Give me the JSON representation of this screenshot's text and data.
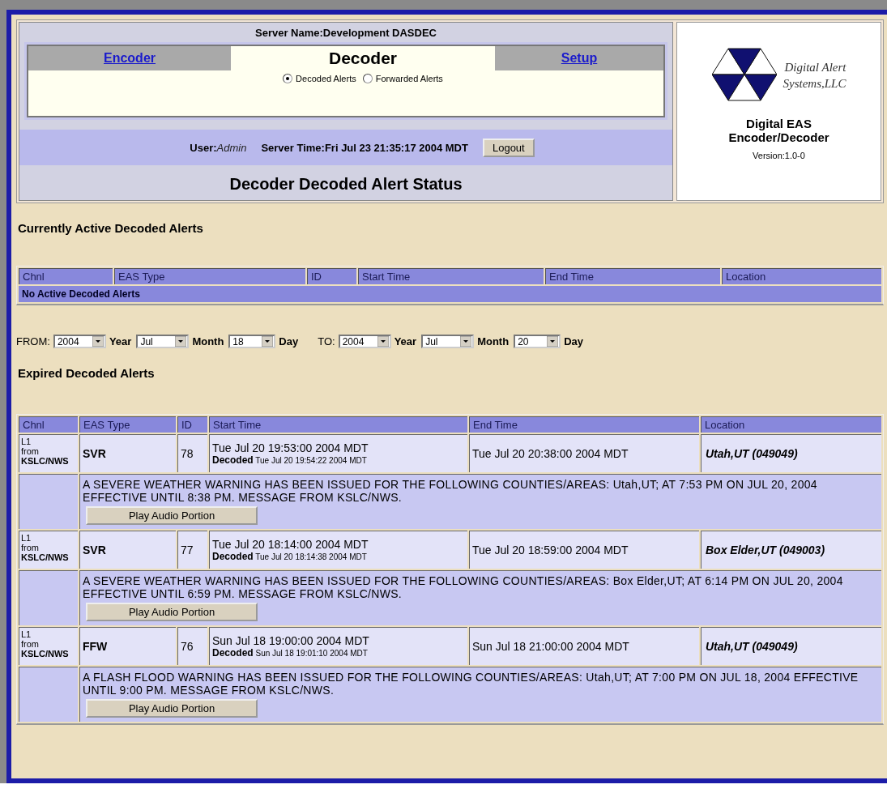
{
  "header": {
    "server_name": "Server Name:Development DASDEC",
    "tabs": [
      {
        "label": "Encoder",
        "selected": false
      },
      {
        "label": "Decoder",
        "selected": true
      },
      {
        "label": "Setup",
        "selected": false
      }
    ],
    "radios": [
      {
        "label": "Decoded Alerts",
        "selected": true
      },
      {
        "label": "Forwarded Alerts",
        "selected": false
      }
    ],
    "user_label": "User:",
    "user": "Admin",
    "server_time": "Server Time:Fri Jul 23 21:35:17 2004 MDT",
    "logout": "Logout",
    "page_title": "Decoder Decoded Alert Status"
  },
  "logo": {
    "company_lines": [
      "Digital Alert",
      "Systems,LLC"
    ],
    "product": "Digital EAS Encoder/Decoder",
    "version": "Version:1.0-0"
  },
  "active": {
    "title": "Currently Active Decoded Alerts",
    "columns": [
      "Chnl",
      "EAS Type",
      "ID",
      "Start Time",
      "End Time",
      "Location"
    ],
    "empty_message": "No Active Decoded Alerts"
  },
  "date_filter": {
    "from_label": "FROM:",
    "to_label": "TO:",
    "from": [
      {
        "value": "2004",
        "unit": "Year"
      },
      {
        "value": "Jul",
        "unit": "Month"
      },
      {
        "value": "18",
        "unit": "Day"
      }
    ],
    "to": [
      {
        "value": "2004",
        "unit": "Year"
      },
      {
        "value": "Jul",
        "unit": "Month"
      },
      {
        "value": "20",
        "unit": "Day"
      }
    ]
  },
  "expired": {
    "title": "Expired Decoded Alerts",
    "columns": [
      "Chnl",
      "EAS Type",
      "ID",
      "Start Time",
      "End Time",
      "Location"
    ],
    "rows": [
      {
        "channel": "L1",
        "channel_from": "from",
        "channel_source": "KSLC/NWS",
        "eas_type": "SVR",
        "id": "78",
        "start_time": "Tue Jul 20 19:53:00 2004 MDT",
        "decoded_label": "Decoded",
        "decoded_time": "Tue Jul 20 19:54:22 2004 MDT",
        "end_time": "Tue Jul 20 20:38:00 2004 MDT",
        "location": "Utah,UT (049049)",
        "message": "A SEVERE WEATHER WARNING HAS BEEN ISSUED FOR THE FOLLOWING COUNTIES/AREAS: Utah,UT; AT 7:53 PM ON JUL 20, 2004 EFFECTIVE UNTIL 8:38 PM. MESSAGE FROM KSLC/NWS.",
        "play_button": "Play Audio Portion"
      },
      {
        "channel": "L1",
        "channel_from": "from",
        "channel_source": "KSLC/NWS",
        "eas_type": "SVR",
        "id": "77",
        "start_time": "Tue Jul 20 18:14:00 2004 MDT",
        "decoded_label": "Decoded",
        "decoded_time": "Tue Jul 20 18:14:38 2004 MDT",
        "end_time": "Tue Jul 20 18:59:00 2004 MDT",
        "location": "Box Elder,UT (049003)",
        "message": "A SEVERE WEATHER WARNING HAS BEEN ISSUED FOR THE FOLLOWING COUNTIES/AREAS: Box Elder,UT; AT 6:14 PM ON JUL 20, 2004 EFFECTIVE UNTIL 6:59 PM. MESSAGE FROM KSLC/NWS.",
        "play_button": "Play Audio Portion"
      },
      {
        "channel": "L1",
        "channel_from": "from",
        "channel_source": "KSLC/NWS",
        "eas_type": "FFW",
        "id": "76",
        "start_time": "Sun Jul 18 19:00:00 2004 MDT",
        "decoded_label": "Decoded",
        "decoded_time": "Sun Jul 18 19:01:10 2004 MDT",
        "end_time": "Sun Jul 18 21:00:00 2004 MDT",
        "location": "Utah,UT (049049)",
        "message": "A FLASH FLOOD WARNING HAS BEEN ISSUED FOR THE FOLLOWING COUNTIES/AREAS: Utah,UT; AT 7:00 PM ON JUL 18, 2004 EFFECTIVE UNTIL 9:00 PM. MESSAGE FROM KSLC/NWS.",
        "play_button": "Play Audio Portion"
      }
    ]
  }
}
